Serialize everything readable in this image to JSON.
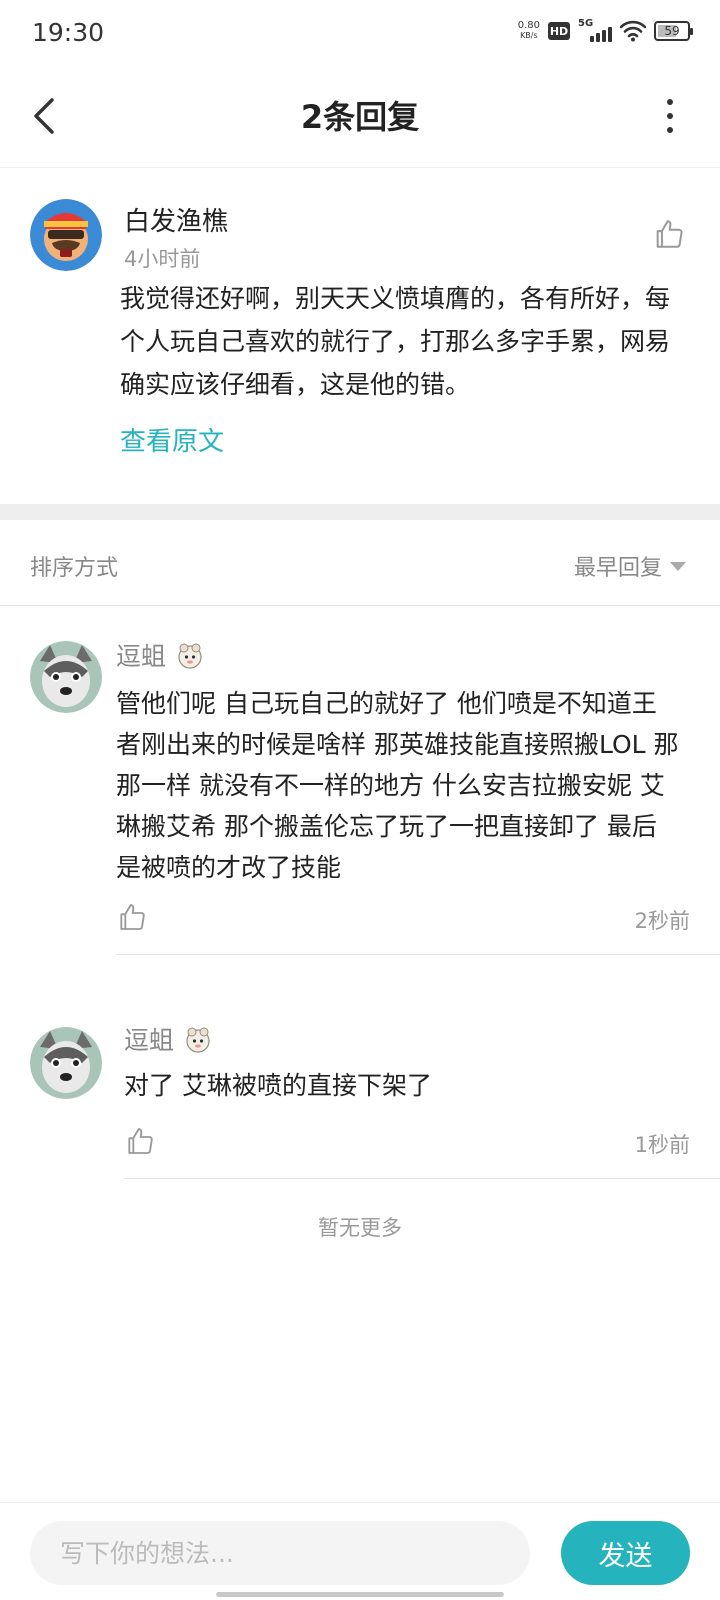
{
  "status_bar": {
    "time": "19:30",
    "net_speed_value": "0.80",
    "net_speed_unit": "KB/s",
    "hd_label": "HD",
    "network_label": "5G",
    "battery_level": "59"
  },
  "header": {
    "title": "2条回复",
    "back_icon": "chevron-left-icon",
    "more_icon": "more-vertical-icon"
  },
  "main_comment": {
    "author": "白发渔樵",
    "time": "4小时前",
    "content": "我觉得还好啊，别天天义愤填膺的，各有所好，每个人玩自己喜欢的就行了，打那么多字手累，网易确实应该仔细看，这是他的错。",
    "view_original": "查看原文",
    "like_icon": "thumbs-up-icon"
  },
  "sort": {
    "label": "排序方式",
    "selected": "最早回复"
  },
  "replies": [
    {
      "author": "逗蛆",
      "content": "管他们呢  自己玩自己的就好了   他们喷是不知道王者刚出来的时候是啥样   那英雄技能直接照搬LOL  那那一样   就没有不一样的地方   什么安吉拉搬安妮   艾琳搬艾希  那个搬盖伦忘了玩了一把直接卸了  最后是被喷的才改了技能",
      "time": "2秒前",
      "like_icon": "thumbs-up-icon"
    },
    {
      "author": "逗蛆",
      "content": "对了  艾琳被喷的直接下架了",
      "time": "1秒前",
      "like_icon": "thumbs-up-icon"
    }
  ],
  "no_more": "暂无更多",
  "bottom_bar": {
    "input_placeholder": "写下你的想法...",
    "send_label": "发送"
  },
  "colors": {
    "accent": "#25b4be",
    "text_primary": "#222222",
    "text_secondary": "#999999",
    "divider": "#eeeeee"
  }
}
